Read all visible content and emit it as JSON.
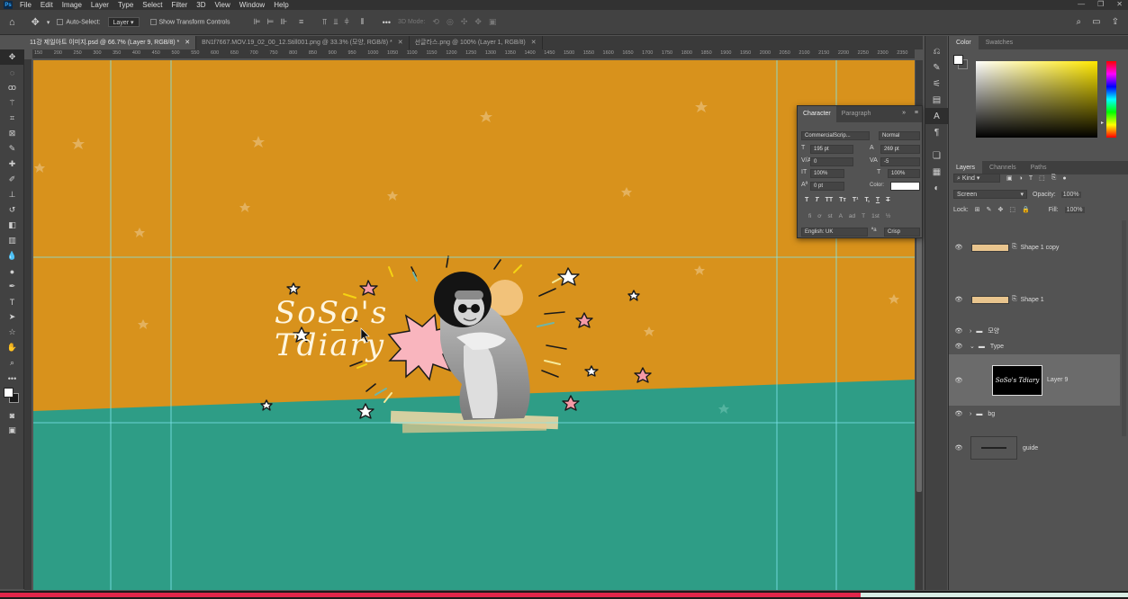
{
  "app": {
    "logo": "Ps",
    "menu": [
      "File",
      "Edit",
      "Image",
      "Layer",
      "Type",
      "Select",
      "Filter",
      "3D",
      "View",
      "Window",
      "Help"
    ],
    "window_controls": [
      "—",
      "❐",
      "✕"
    ]
  },
  "options_bar": {
    "auto_select_label": "Auto-Select:",
    "auto_select_target": "Layer",
    "show_transform_label": "Show Transform Controls",
    "more_label": "•••",
    "mode_3d_label": "3D Mode:"
  },
  "tabs": [
    {
      "label": "11강 제일아트 이미지.psd @ 66.7% (Layer 9, RGB/8) *",
      "close": "✕",
      "active": true
    },
    {
      "label": "BN1f7667.MOV.19_02_00_12.Still001.png @ 33.3% (모양, RGB/8) *",
      "close": "✕",
      "active": false
    },
    {
      "label": "선글라스.png @ 100% (Layer 1, RGB/8)",
      "close": "✕",
      "active": false
    }
  ],
  "ruler_marks": [
    "150",
    "200",
    "250",
    "300",
    "350",
    "400",
    "450",
    "500",
    "550",
    "600",
    "650",
    "700",
    "750",
    "800",
    "850",
    "900",
    "950",
    "1000",
    "1050",
    "1100",
    "1150",
    "1200",
    "1250",
    "1300",
    "1350",
    "1400",
    "1450",
    "1500",
    "1550",
    "1600",
    "1650",
    "1700",
    "1750",
    "1800",
    "1850",
    "1900",
    "1950",
    "2000",
    "2050",
    "2100",
    "2150",
    "2200",
    "2250",
    "2300",
    "2350"
  ],
  "canvas": {
    "title_line1": "SoSo's",
    "title_line2": "Tdiary",
    "colors": {
      "orange": "#d8921c",
      "teal": "#2e9d86",
      "pink": "#f9b5be",
      "tape": "#f2d9a6"
    }
  },
  "character_panel": {
    "tabs": [
      "Character",
      "Paragraph"
    ],
    "font_family": "CommercialScrip...",
    "font_style": "Normal",
    "font_size": "195 pt",
    "leading": "269 pt",
    "kerning": "0",
    "tracking": "-5",
    "vertical_scale": "100%",
    "horizontal_scale": "100%",
    "baseline_shift": "0 pt",
    "color_label": "Color:",
    "type_buttons": [
      "T",
      "T",
      "TT",
      "Tт",
      "T¹",
      "T,",
      "T",
      "T"
    ],
    "ot_buttons": [
      "fi",
      "ơ",
      "st",
      "A",
      "ad",
      "T",
      "1st",
      "½"
    ],
    "language": "English: UK",
    "aa_label": "ªa",
    "antialias": "Crisp"
  },
  "color_panel": {
    "tabs": [
      "Color",
      "Swatches"
    ]
  },
  "layers_panel": {
    "tabs": [
      "Layers",
      "Channels",
      "Paths"
    ],
    "filter_kind": "Kind",
    "blend_mode": "Screen",
    "opacity_label": "Opacity:",
    "opacity": "100%",
    "lock_label": "Lock:",
    "fill_label": "Fill:",
    "fill": "100%",
    "layers": [
      {
        "name": "Shape 1 copy",
        "type": "shape"
      },
      {
        "name": "Shape 1",
        "type": "shape"
      },
      {
        "name": "모양",
        "type": "group",
        "collapsed": true
      },
      {
        "name": "Type",
        "type": "group",
        "collapsed": false
      },
      {
        "name": "Layer 9",
        "type": "text-thumb",
        "selected": true,
        "thumb_text": "SoSo's Tdiary"
      },
      {
        "name": "bg",
        "type": "group",
        "collapsed": true
      },
      {
        "name": "guide",
        "type": "image"
      }
    ]
  },
  "video": {
    "played_fraction": 0.763,
    "buffered_fraction": 1.0,
    "colors": {
      "played": "#e2264a",
      "buffered": "#d8ece4"
    }
  }
}
